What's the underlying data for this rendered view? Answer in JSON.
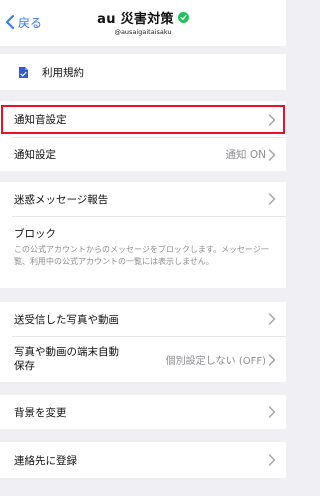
{
  "header": {
    "back_label": "戻る",
    "title": "au 災害対策",
    "handle": "@ausaigaitaisaku"
  },
  "terms": {
    "label": "利用規約"
  },
  "notification": {
    "sound_label": "通知音設定",
    "settings_label": "通知設定",
    "settings_value": "通知 ON"
  },
  "spam": {
    "report_label": "迷惑メッセージ報告",
    "block_label": "ブロック",
    "block_desc": "この公式アカウントからのメッセージをブロックします。メッセージ一覧、利用中の公式アカウントの一覧には表示しません。"
  },
  "media": {
    "sent_label": "送受信した写真や動画",
    "autosave_label_line1": "写真や動画の端末自動",
    "autosave_label_line2": "保存",
    "autosave_value": "個別設定しない (OFF)"
  },
  "background": {
    "label": "背景を変更"
  },
  "contacts": {
    "label": "連絡先に登録"
  },
  "colors": {
    "accent": "#3478f6",
    "highlight": "#e8102a",
    "verified": "#21c35b",
    "doc_icon": "#2f5bd8"
  },
  "icons": [
    "chevron-left-icon",
    "verified-check-icon",
    "document-icon",
    "chevron-right-icon"
  ]
}
